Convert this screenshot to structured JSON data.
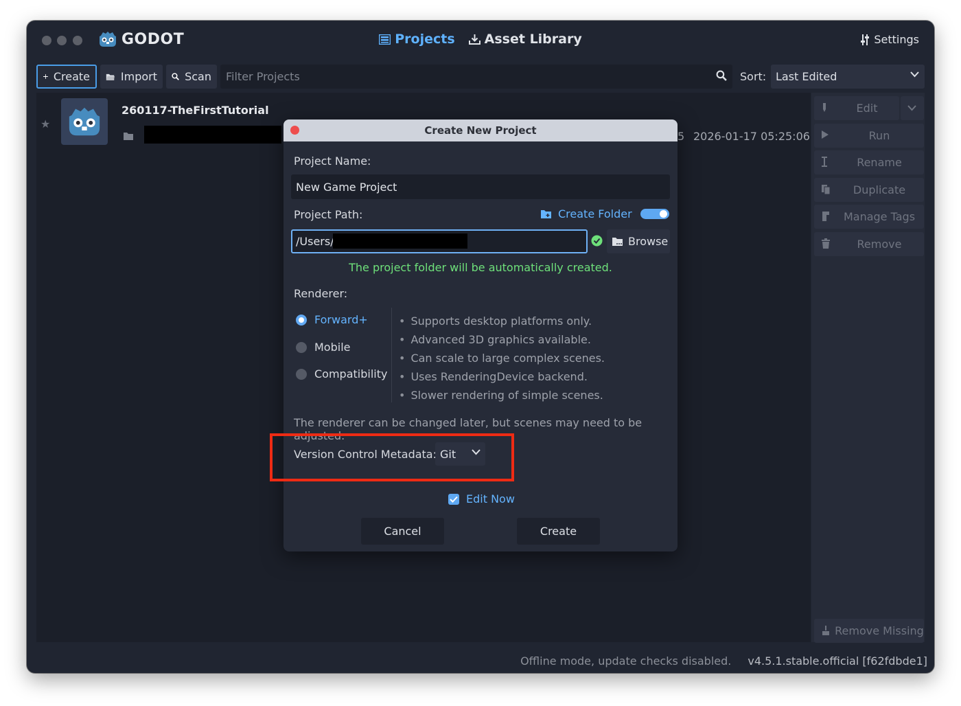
{
  "titlebar": {
    "logo_text": "GODOT",
    "nav": [
      {
        "label": "Projects",
        "icon": "projects-list-icon",
        "active": true
      },
      {
        "label": "Asset Library",
        "icon": "download-icon",
        "active": false
      }
    ],
    "settings_label": "Settings"
  },
  "toolbar": {
    "create_label": "Create",
    "import_label": "Import",
    "scan_label": "Scan",
    "filter_placeholder": "Filter Projects",
    "sort_label": "Sort:",
    "sort_value": "Last Edited"
  },
  "projects": [
    {
      "name": "260117-TheFirstTutorial",
      "path_suffix": "5",
      "date": "2026-01-17 05:25:06",
      "favorite": false
    }
  ],
  "side_actions": {
    "edit": "Edit",
    "run": "Run",
    "rename": "Rename",
    "duplicate": "Duplicate",
    "manage_tags": "Manage Tags",
    "remove": "Remove",
    "remove_missing": "Remove Missing"
  },
  "status_bar": {
    "message": "Offline mode, update checks disabled.",
    "version": "v4.5.1.stable.official [f62fdbde1]"
  },
  "dialog": {
    "title": "Create New Project",
    "project_name_label": "Project Name:",
    "project_name_value": "New Game Project",
    "project_path_label": "Project Path:",
    "create_folder_label": "Create Folder",
    "create_folder_enabled": true,
    "path_value": "/Users/",
    "browse_label": "Browse",
    "status_message": "The project folder will be automatically created.",
    "renderer_label": "Renderer:",
    "renderers": [
      {
        "label": "Forward+",
        "selected": true
      },
      {
        "label": "Mobile",
        "selected": false
      },
      {
        "label": "Compatibility",
        "selected": false
      }
    ],
    "renderer_notes": [
      "Supports desktop platforms only.",
      "Advanced 3D graphics available.",
      "Can scale to large complex scenes.",
      "Uses RenderingDevice backend.",
      "Slower rendering of simple scenes."
    ],
    "renderer_hint": "The renderer can be changed later, but scenes may need to be adjusted.",
    "vc_label": "Version Control Metadata:",
    "vc_value": "Git",
    "edit_now_label": "Edit Now",
    "edit_now_checked": true,
    "cancel_label": "Cancel",
    "create_label": "Create"
  },
  "colors": {
    "accent": "#5fb2ff",
    "success": "#6ee07a",
    "highlight": "#ee2b14",
    "window_bg": "#202531"
  }
}
